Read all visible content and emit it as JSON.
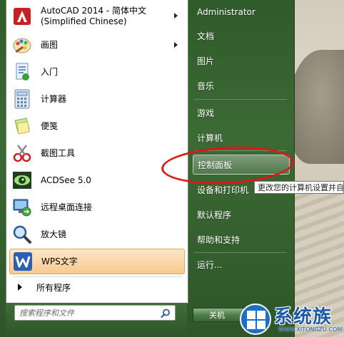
{
  "programs": [
    {
      "label_line1": "AutoCAD 2014 - 简体中文",
      "label_line2": "(Simplified Chinese)",
      "icon": "autocad-icon",
      "has_submenu": true
    },
    {
      "label": "画图",
      "icon": "paint-icon",
      "has_submenu": true
    },
    {
      "label": "入门",
      "icon": "getting-started-icon",
      "has_submenu": false
    },
    {
      "label": "计算器",
      "icon": "calculator-icon",
      "has_submenu": false
    },
    {
      "label": "便笺",
      "icon": "sticky-notes-icon",
      "has_submenu": false
    },
    {
      "label": "截图工具",
      "icon": "snipping-tool-icon",
      "has_submenu": false
    },
    {
      "label": "ACDSee 5.0",
      "icon": "acdsee-icon",
      "has_submenu": false
    },
    {
      "label": "远程桌面连接",
      "icon": "remote-desktop-icon",
      "has_submenu": false
    },
    {
      "label": "放大镜",
      "icon": "magnifier-icon",
      "has_submenu": false
    },
    {
      "label": "WPS文字",
      "icon": "wps-writer-icon",
      "has_submenu": false,
      "highlighted": true
    }
  ],
  "all_programs_label": "所有程序",
  "search": {
    "placeholder": "搜索程序和文件"
  },
  "right_items": [
    {
      "label": "Administrator"
    },
    {
      "label": "文档"
    },
    {
      "label": "图片"
    },
    {
      "label": "音乐"
    },
    {
      "label": "游戏"
    },
    {
      "label": "计算机"
    },
    {
      "label": "控制面板",
      "selected": true
    },
    {
      "label": "设备和打印机"
    },
    {
      "label": "默认程序"
    },
    {
      "label": "帮助和支持"
    },
    {
      "label": "运行..."
    }
  ],
  "shutdown_label": "关机",
  "tooltip": "更改您的计算机设置并自定义其功能",
  "watermark": {
    "text": "系统族",
    "url": "WWW.XITONGZU.COM"
  },
  "colors": {
    "annotation": "#e01616",
    "highlight": "#f8c98e",
    "frame": "#3c6a35"
  }
}
